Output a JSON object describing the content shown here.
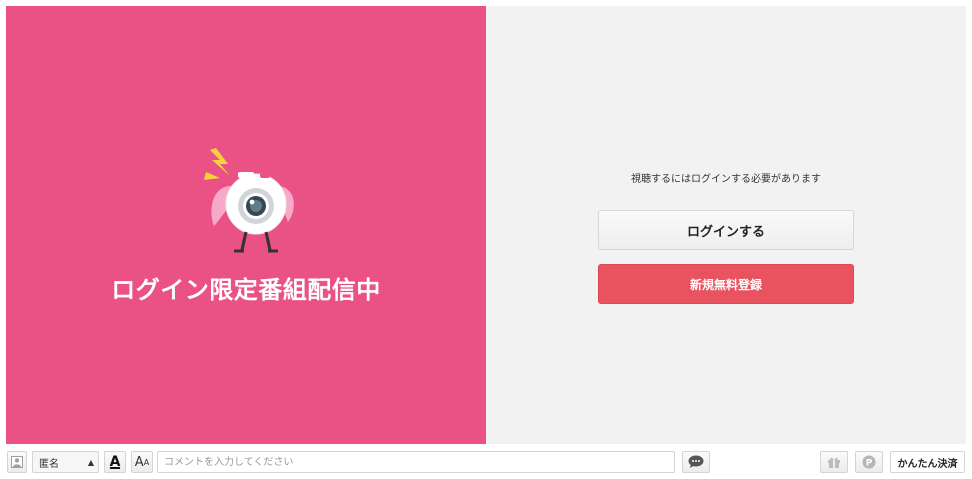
{
  "promo": {
    "title": "ログイン限定番組配信中"
  },
  "login": {
    "message": "視聴するにはログインする必要があります",
    "login_button": "ログインする",
    "register_button": "新規無料登録"
  },
  "comment_bar": {
    "name_select": "匿名",
    "font_button": "A",
    "size_button": "A",
    "size_button_sub": "A",
    "input_placeholder": "コメントを入力してください",
    "pay_button": "かんたん決済"
  },
  "icons": {
    "avatar": "user-avatar-icon",
    "send": "speech-bubble-icon",
    "gift": "gift-icon",
    "point": "point-p-icon",
    "mascot": "camera-mascot-icon"
  },
  "colors": {
    "promo_bg": "#ea5185",
    "panel_bg": "#f2f2f2",
    "register_bg": "#e9525f"
  }
}
